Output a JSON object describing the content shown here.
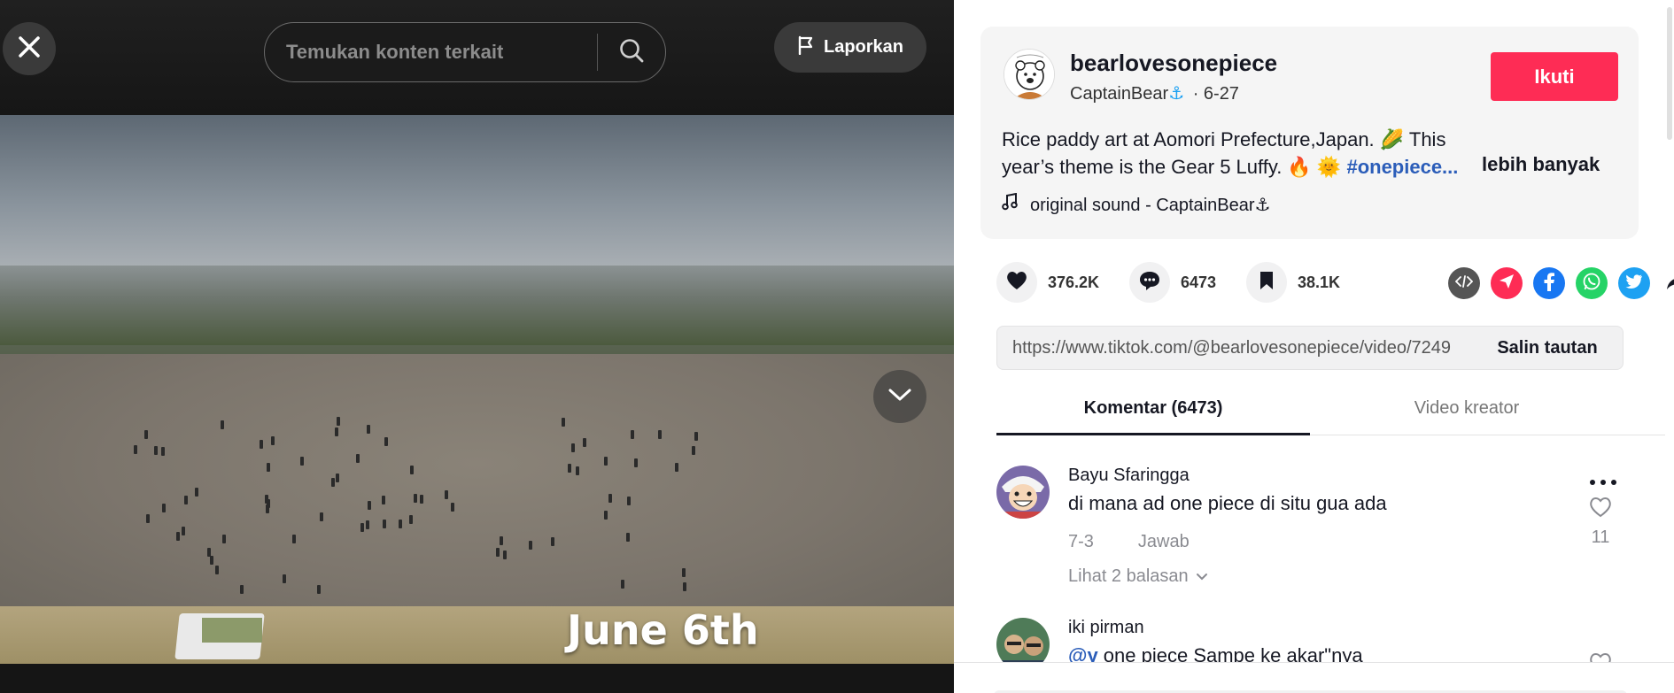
{
  "video": {
    "search_placeholder": "Temukan konten terkait",
    "report_label": "Laporkan",
    "caption": "June 6th"
  },
  "author": {
    "username": "bearlovesonepiece",
    "nickname": "CaptainBear",
    "nickname_emoji": "⚓",
    "date": "· 6-27",
    "follow_label": "Ikuti",
    "description_part1": "Rice paddy art at Aomori Prefecture,Japan. 🌽 This year’s theme is the Gear 5 Luffy. 🔥 🌞",
    "hashtag": "#onepiece...",
    "more_label": "lebih banyak",
    "music": "original sound - CaptainBear⚓"
  },
  "actions": {
    "likes": "376.2K",
    "comments": "6473",
    "saves": "38.1K"
  },
  "share": {
    "link": "https://www.tiktok.com/@bearlovesonepiece/video/7249",
    "copy_label": "Salin tautan"
  },
  "tabs": {
    "comments_tab": "Komentar (6473)",
    "creator_tab": "Video kreator"
  },
  "comments": [
    {
      "name": "Bayu Sfaringga",
      "text": "di mana ad one piece di situ gua ada",
      "date": "7-3",
      "reply_label": "Jawab",
      "likes": "11",
      "view_replies": "Lihat 2 balasan"
    },
    {
      "name": "iki pirman",
      "mention": "@y",
      "text": " one piece Sampe ke akar\"nya"
    }
  ],
  "colors": {
    "follow": "#fe2c55",
    "hashtag": "#2b5db9",
    "whatsapp": "#25d366",
    "facebook": "#1877f2",
    "twitter": "#1da1f2",
    "telegram_like": "#fe2c55",
    "embed": "#555555"
  },
  "icons": {
    "close": "close-icon",
    "search": "search-icon",
    "report": "flag-icon",
    "down": "chevron-down-icon",
    "like": "heart-icon",
    "comment": "comment-icon",
    "save": "bookmark-icon",
    "music": "music-note-icon"
  }
}
